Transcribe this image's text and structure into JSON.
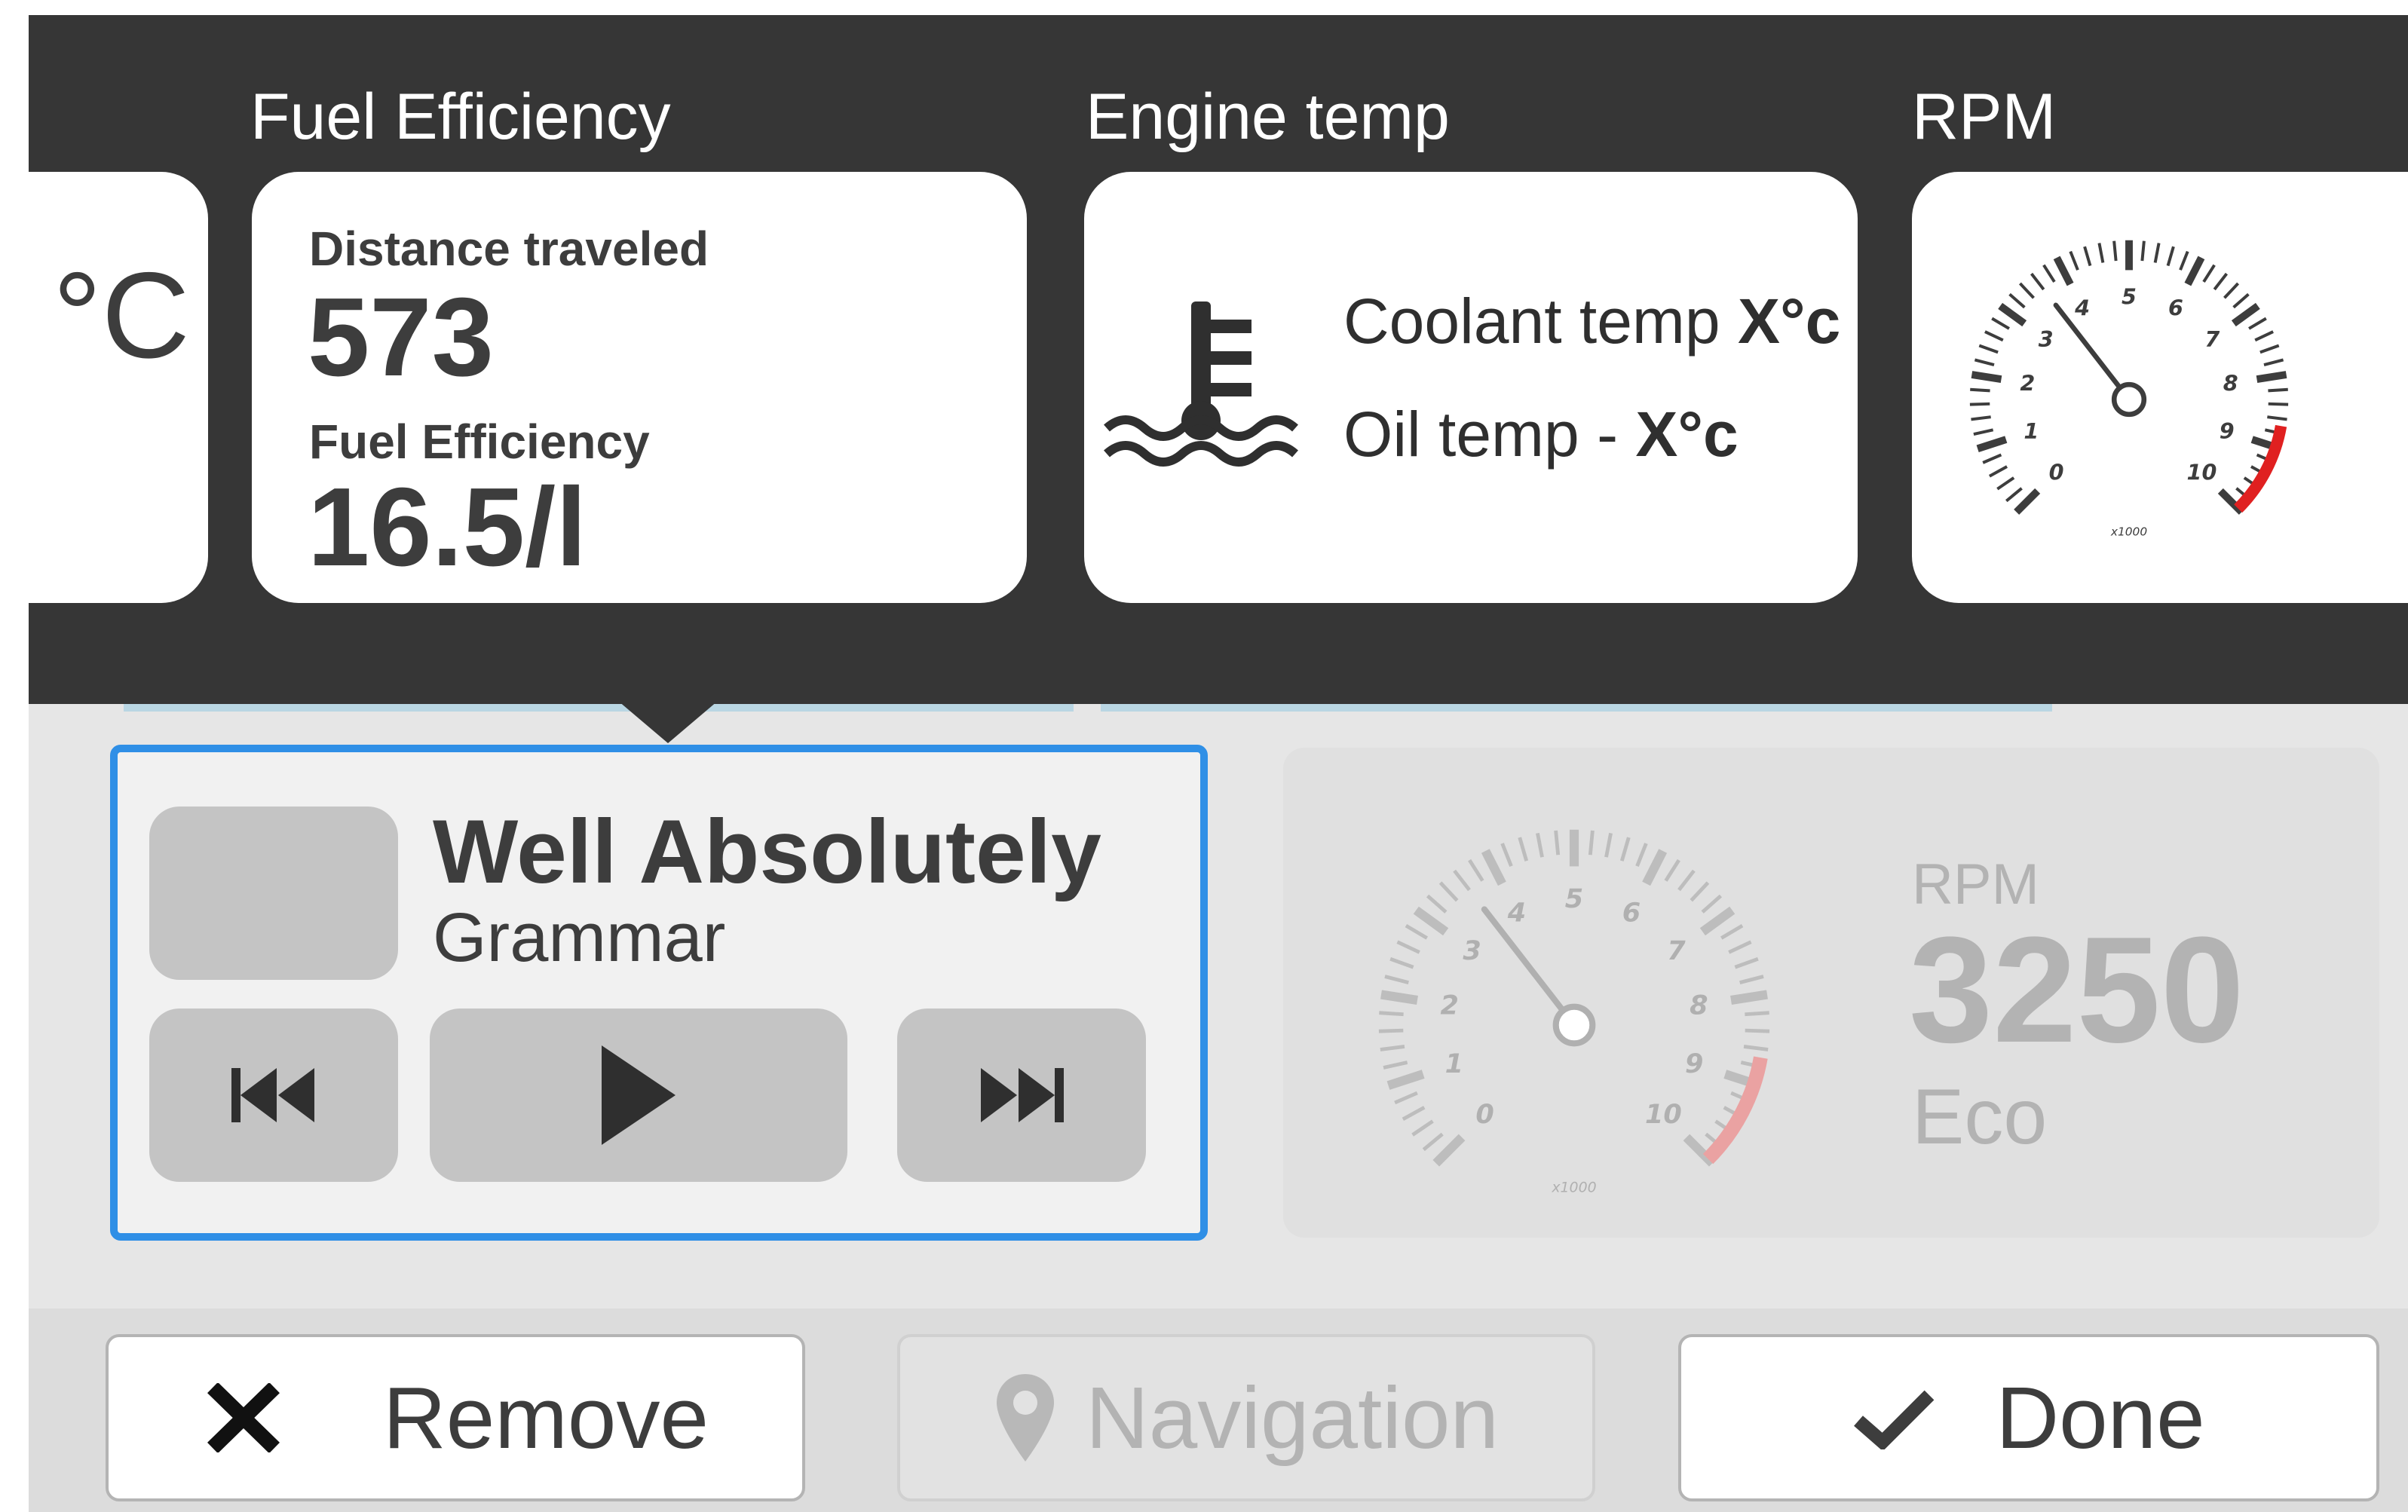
{
  "top_widgets": {
    "partial_left": {
      "unit": "°C"
    },
    "fuel_efficiency": {
      "title": "Fuel Efficiency",
      "distance_label": "Distance traveled",
      "distance_value": "573",
      "efficiency_label": "Fuel Efficiency",
      "efficiency_value": "16.5/l"
    },
    "engine_temp": {
      "title": "Engine temp",
      "coolant_label": "Coolant temp",
      "coolant_value": "X°c",
      "oil_label": "Oil temp -",
      "oil_value": "X°c"
    },
    "rpm": {
      "title": "RPM",
      "gauge_ticks": [
        "0",
        "1",
        "2",
        "3",
        "4",
        "5",
        "6",
        "7",
        "8",
        "9",
        "10"
      ],
      "multiplier": "x1000"
    }
  },
  "media_widget": {
    "track_title": "Well Absolutely",
    "artist": "Grammar",
    "icons": [
      "previous-track-icon",
      "play-icon",
      "next-track-icon"
    ]
  },
  "rpm_widget": {
    "label": "RPM",
    "value": "3250",
    "mode": "Eco",
    "multiplier": "x1000",
    "gauge_ticks": [
      "0",
      "1",
      "2",
      "3",
      "4",
      "5",
      "6",
      "7",
      "8",
      "9",
      "10"
    ]
  },
  "bottom_actions": {
    "remove_label": "Remove",
    "navigation_label": "Navigation",
    "done_label": "Done"
  },
  "colors": {
    "panel_dark": "#363636",
    "selection_blue": "#2f8fe6",
    "redline": "#e02020",
    "redline_faded": "#eaa2a2",
    "text_dark": "#3d3d3d",
    "text_muted": "#b3b3b3"
  }
}
